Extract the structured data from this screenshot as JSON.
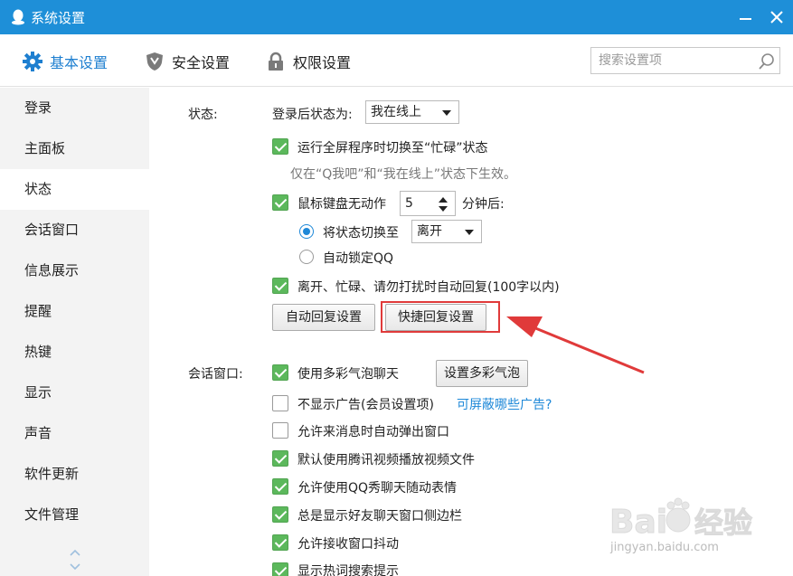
{
  "window": {
    "title": "系统设置"
  },
  "tabs": [
    {
      "label": "基本设置",
      "icon": "gear-icon",
      "active": true
    },
    {
      "label": "安全设置",
      "icon": "shield-icon",
      "active": false
    },
    {
      "label": "权限设置",
      "icon": "lock-icon",
      "active": false
    }
  ],
  "search": {
    "placeholder": "搜索设置项",
    "value": ""
  },
  "sidebar": {
    "items": [
      {
        "label": "登录"
      },
      {
        "label": "主面板"
      },
      {
        "label": "状态",
        "active": true
      },
      {
        "label": "会话窗口"
      },
      {
        "label": "信息展示"
      },
      {
        "label": "提醒"
      },
      {
        "label": "热键"
      },
      {
        "label": "显示"
      },
      {
        "label": "声音"
      },
      {
        "label": "软件更新"
      },
      {
        "label": "文件管理"
      }
    ]
  },
  "status_section": {
    "title": "状态:",
    "login_status_label": "登录后状态为:",
    "login_status_value": "我在线上",
    "fullscreen_busy": {
      "label": "运行全屏程序时切换至“忙碌”状态",
      "checked": true
    },
    "fullscreen_hint": "仅在“Q我吧”和“我在线上”状态下生效。",
    "idle": {
      "label": "鼠标键盘无动作",
      "checked": true,
      "minutes": "5",
      "suffix": "分钟后:"
    },
    "switch_to": {
      "label": "将状态切换至",
      "selected": true,
      "value": "离开"
    },
    "auto_lock": {
      "label": "自动锁定QQ",
      "selected": false
    },
    "auto_reply": {
      "label": "离开、忙碌、请勿打扰时自动回复(100字以内)",
      "checked": true
    },
    "auto_reply_button": "自动回复设置",
    "quick_reply_button": "快捷回复设置"
  },
  "chat_section": {
    "title": "会话窗口:",
    "bubble": {
      "label": "使用多彩气泡聊天",
      "checked": true,
      "button": "设置多彩气泡"
    },
    "no_ads": {
      "label": "不显示广告(会员设置项)",
      "checked": false,
      "link": "可屏蔽哪些广告?"
    },
    "auto_popup": {
      "label": "允许来消息时自动弹出窗口",
      "checked": false
    },
    "tencent_video": {
      "label": "默认使用腾讯视频播放视频文件",
      "checked": true
    },
    "qq_show": {
      "label": "允许使用QQ秀聊天随动表情",
      "checked": true
    },
    "sidebar": {
      "label": "总是显示好友聊天窗口侧边栏",
      "checked": true
    },
    "shake": {
      "label": "允许接收窗口抖动",
      "checked": true
    },
    "hot_words": {
      "label": "显示热词搜索提示",
      "checked": true
    }
  },
  "watermark": {
    "text": "jingyan.baidu.com",
    "logo": "Baidu经验"
  },
  "colors": {
    "titlebar": "#1e8fd8",
    "accent": "#1e7fd0",
    "checkbox": "#5cb85c",
    "highlight": "#e03a3a"
  }
}
